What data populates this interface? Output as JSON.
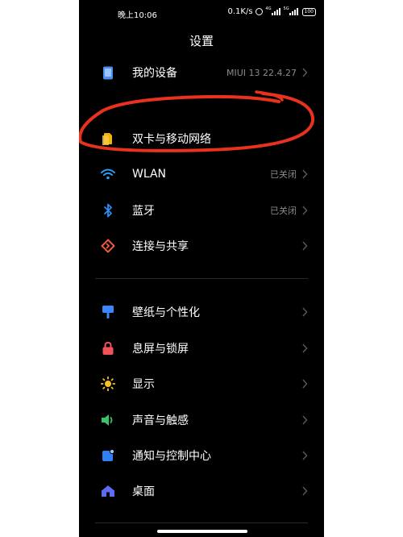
{
  "status_bar": {
    "time": "晚上10:06",
    "net_speed": "0.1K/s",
    "sim1_tag": "4G",
    "sim2_tag": "5G",
    "battery": "100"
  },
  "header": {
    "title": "设置"
  },
  "sections": [
    {
      "items": [
        {
          "label": "我的设备",
          "value": "MIUI 13 22.4.27",
          "icon": "device-icon"
        }
      ]
    },
    {
      "items": [
        {
          "label": "双卡与移动网络",
          "value": "",
          "icon": "sim-card-icon"
        },
        {
          "label": "WLAN",
          "value": "已关闭",
          "icon": "wifi-icon"
        },
        {
          "label": "蓝牙",
          "value": "已关闭",
          "icon": "bluetooth-icon"
        },
        {
          "label": "连接与共享",
          "value": "",
          "icon": "connection-share-icon"
        }
      ]
    },
    {
      "items": [
        {
          "label": "壁纸与个性化",
          "value": "",
          "icon": "wallpaper-icon"
        },
        {
          "label": "息屏与锁屏",
          "value": "",
          "icon": "lock-icon"
        },
        {
          "label": "显示",
          "value": "",
          "icon": "brightness-icon"
        },
        {
          "label": "声音与触感",
          "value": "",
          "icon": "speaker-icon"
        },
        {
          "label": "通知与控制中心",
          "value": "",
          "icon": "notification-icon"
        },
        {
          "label": "桌面",
          "value": "",
          "icon": "home-icon"
        }
      ]
    }
  ],
  "colors": {
    "background": "#000000",
    "text": "#ffffff",
    "secondary_text": "#8a8a8a",
    "annotation": "#e8321e",
    "device": "#4a8ef0",
    "sim": "#f5b400",
    "wifi": "#2e9cf2",
    "bluetooth": "#2e8cf0",
    "share": "#ee5a3a",
    "wallpaper": "#3a86ff",
    "lock": "#f0525a",
    "display": "#f5c02c",
    "sound": "#39c467",
    "notification": "#2f7ff5",
    "home": "#5d6af2"
  }
}
